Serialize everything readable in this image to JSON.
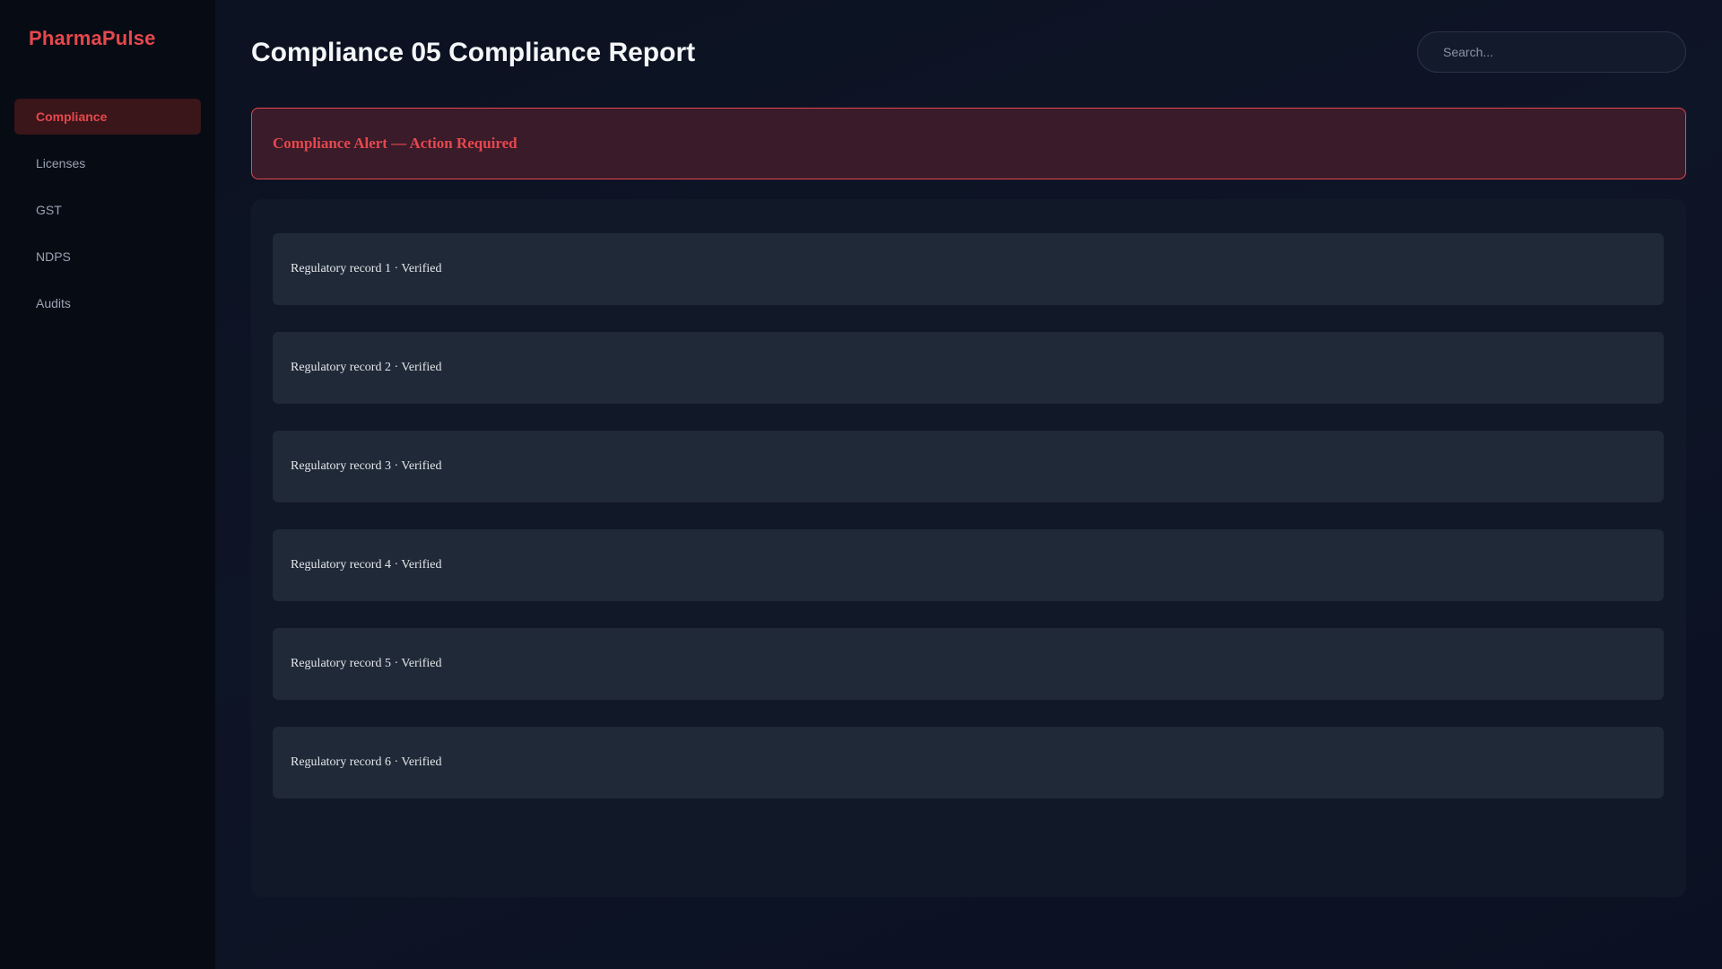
{
  "app": {
    "brand": "PharmaPulse"
  },
  "sidebar": {
    "items": [
      {
        "label": "Compliance",
        "active": true
      },
      {
        "label": "Licenses",
        "active": false
      },
      {
        "label": "GST",
        "active": false
      },
      {
        "label": "NDPS",
        "active": false
      },
      {
        "label": "Audits",
        "active": false
      }
    ]
  },
  "header": {
    "title": "Compliance 05 Compliance Report",
    "search_placeholder": "Search..."
  },
  "alert": {
    "text": "Compliance Alert — Action Required"
  },
  "records": [
    {
      "text": "Regulatory record 1 · Verified"
    },
    {
      "text": "Regulatory record 2 · Verified"
    },
    {
      "text": "Regulatory record 3 · Verified"
    },
    {
      "text": "Regulatory record 4 · Verified"
    },
    {
      "text": "Regulatory record 5 · Verified"
    },
    {
      "text": "Regulatory record 6 · Verified"
    }
  ],
  "colors": {
    "accent": "#e5484d",
    "background": "#0b1120",
    "sidebar": "#070b14",
    "card": "#1f2937"
  }
}
